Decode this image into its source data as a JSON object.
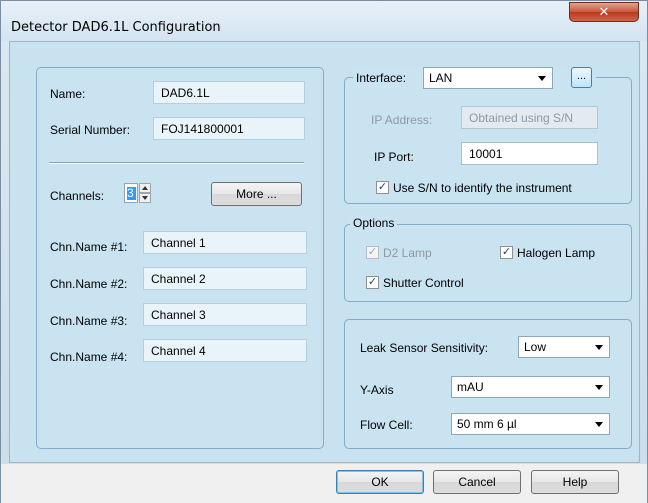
{
  "window": {
    "title": "Detector DAD6.1L Configuration",
    "close_glyph": "✕"
  },
  "identity": {
    "name_label": "Name:",
    "name_value": "DAD6.1L",
    "serial_label": "Serial Number:",
    "serial_value": "FOJ141800001"
  },
  "channels": {
    "label": "Channels:",
    "value": "3",
    "more_button": "More ...",
    "names": [
      {
        "label": "Chn.Name #1:",
        "value": "Channel 1"
      },
      {
        "label": "Chn.Name #2:",
        "value": "Channel 2"
      },
      {
        "label": "Chn.Name #3:",
        "value": "Channel 3"
      },
      {
        "label": "Chn.Name #4:",
        "value": "Channel 4"
      }
    ]
  },
  "interface": {
    "label": "Interface:",
    "selected": "LAN",
    "browse_button": "...",
    "ip_address_label": "IP Address:",
    "ip_address_value": "Obtained using S/N",
    "ip_port_label": "IP Port:",
    "ip_port_value": "10001",
    "use_sn_label": "Use S/N to identify the instrument",
    "use_sn_checked": true
  },
  "options": {
    "legend": "Options",
    "d2_lamp_label": "D2 Lamp",
    "d2_lamp_checked": true,
    "halogen_lamp_label": "Halogen Lamp",
    "halogen_lamp_checked": true,
    "shutter_control_label": "Shutter Control",
    "shutter_control_checked": true
  },
  "settings": {
    "leak_label": "Leak Sensor Sensitivity:",
    "leak_value": "Low",
    "yaxis_label": "Y-Axis",
    "yaxis_value": "mAU",
    "flowcell_label": "Flow Cell:",
    "flowcell_value": "50 mm 6 µl"
  },
  "footer": {
    "ok": "OK",
    "cancel": "Cancel",
    "help": "Help"
  },
  "check_glyph": "✓"
}
